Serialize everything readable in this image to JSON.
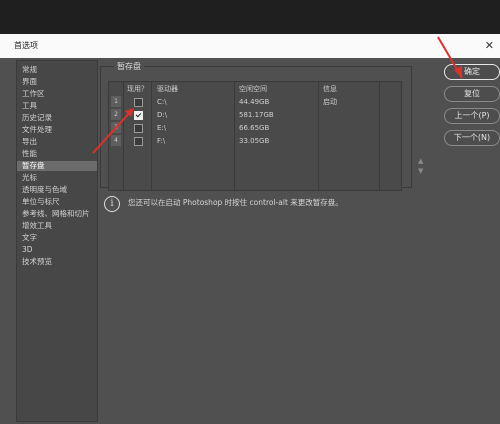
{
  "dialog": {
    "title": "首选项",
    "close_glyph": "✕"
  },
  "sidebar": {
    "items": [
      {
        "label": "常规"
      },
      {
        "label": "界面"
      },
      {
        "label": "工作区"
      },
      {
        "label": "工具"
      },
      {
        "label": "历史记录"
      },
      {
        "label": "文件处理"
      },
      {
        "label": "导出"
      },
      {
        "label": "性能"
      },
      {
        "label": "暂存盘",
        "selected": true
      },
      {
        "label": "光标"
      },
      {
        "label": "透明度与色域"
      },
      {
        "label": "单位与标尺"
      },
      {
        "label": "参考线、网格和切片"
      },
      {
        "label": "增效工具"
      },
      {
        "label": "文字"
      },
      {
        "label": "3D"
      },
      {
        "label": "技术预览"
      }
    ]
  },
  "scratch": {
    "group_title": "暂存盘",
    "columns": {
      "active": "现用？",
      "drive": "驱动器",
      "free": "空闲空间",
      "info": "信息"
    },
    "rows": [
      {
        "num": "1",
        "checked": false,
        "drive": "C:\\",
        "free": "44.49GB",
        "info": "启动"
      },
      {
        "num": "2",
        "checked": true,
        "drive": "D:\\",
        "free": "581.17GB",
        "info": ""
      },
      {
        "num": "3",
        "checked": false,
        "drive": "E:\\",
        "free": "66.65GB",
        "info": ""
      },
      {
        "num": "4",
        "checked": false,
        "drive": "F:\\",
        "free": "33.05GB",
        "info": ""
      }
    ],
    "up_glyph": "▲",
    "down_glyph": "▼"
  },
  "info": {
    "icon": "info-icon",
    "text": "您还可以在启动 Photoshop 时按住 control-alt 来更改暂存盘。"
  },
  "buttons": {
    "ok": "确定",
    "reset": "复位",
    "prev": "上一个(P)",
    "next": "下一个(N)"
  },
  "colors": {
    "annotation_arrow": "#e0302a"
  }
}
